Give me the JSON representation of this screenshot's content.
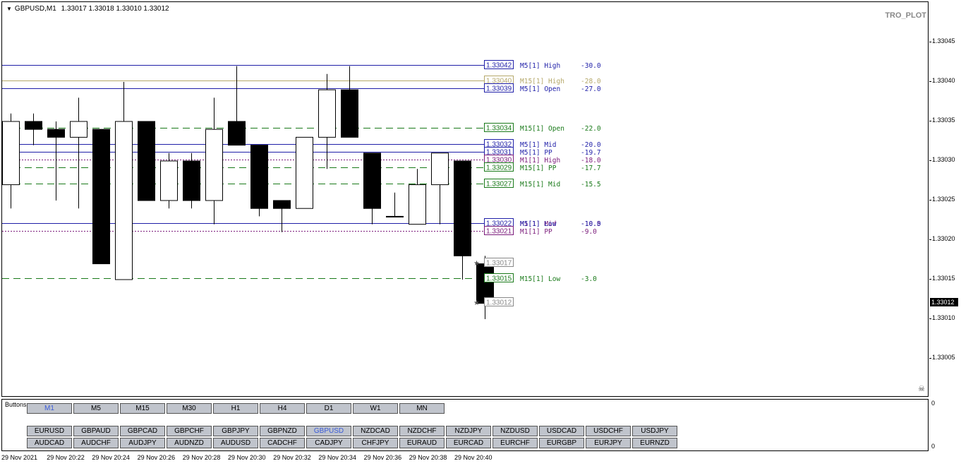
{
  "header": {
    "symbol": "GBPUSD,M1",
    "open": "1.33017",
    "high": "1.33018",
    "low": "1.33010",
    "close": "1.33012"
  },
  "plot_name": "TRO_PLOT",
  "current_price": "1.33012",
  "price_axis": [
    "1.33045",
    "1.33040",
    "1.33035",
    "1.33030",
    "1.33025",
    "1.33020",
    "1.33015",
    "1.33010",
    "1.33005"
  ],
  "colors": {
    "blue": "#1f1fa8",
    "olive": "#b5a86a",
    "green": "#1a7a1a",
    "purple": "#7a1a7a",
    "gray": "#888888"
  },
  "candles": [
    {
      "o": 1.33027,
      "h": 1.33036,
      "l": 1.33024,
      "c": 1.33035
    },
    {
      "o": 1.33035,
      "h": 1.33036,
      "l": 1.33032,
      "c": 1.33034
    },
    {
      "o": 1.33034,
      "h": 1.33035,
      "l": 1.33025,
      "c": 1.33033
    },
    {
      "o": 1.33033,
      "h": 1.33038,
      "l": 1.33024,
      "c": 1.33035
    },
    {
      "o": 1.33034,
      "h": 1.33034,
      "l": 1.33017,
      "c": 1.33017
    },
    {
      "o": 1.33015,
      "h": 1.3304,
      "l": 1.33015,
      "c": 1.33035
    },
    {
      "o": 1.33035,
      "h": 1.33035,
      "l": 1.33025,
      "c": 1.33025
    },
    {
      "o": 1.33025,
      "h": 1.33031,
      "l": 1.33024,
      "c": 1.3303
    },
    {
      "o": 1.3303,
      "h": 1.33031,
      "l": 1.33024,
      "c": 1.33025
    },
    {
      "o": 1.33025,
      "h": 1.33038,
      "l": 1.33022,
      "c": 1.33034
    },
    {
      "o": 1.33035,
      "h": 1.33042,
      "l": 1.33032,
      "c": 1.33032
    },
    {
      "o": 1.33032,
      "h": 1.33032,
      "l": 1.33023,
      "c": 1.33024
    },
    {
      "o": 1.33025,
      "h": 1.33025,
      "l": 1.33021,
      "c": 1.33024
    },
    {
      "o": 1.33024,
      "h": 1.33033,
      "l": 1.33024,
      "c": 1.33033
    },
    {
      "o": 1.33033,
      "h": 1.33041,
      "l": 1.33029,
      "c": 1.33039
    },
    {
      "o": 1.33039,
      "h": 1.33042,
      "l": 1.33033,
      "c": 1.33033
    },
    {
      "o": 1.33031,
      "h": 1.33031,
      "l": 1.33022,
      "c": 1.33024
    },
    {
      "o": 1.33023,
      "h": 1.33026,
      "l": 1.33023,
      "c": 1.33023
    },
    {
      "o": 1.33022,
      "h": 1.33029,
      "l": 1.33022,
      "c": 1.33027
    },
    {
      "o": 1.33027,
      "h": 1.33031,
      "l": 1.33022,
      "c": 1.33031
    },
    {
      "o": 1.3303,
      "h": 1.3303,
      "l": 1.33015,
      "c": 1.33018
    },
    {
      "o": 1.33017,
      "h": 1.33018,
      "l": 1.3301,
      "c": 1.33012
    }
  ],
  "levels": [
    {
      "price": 1.33042,
      "label": "1.33042",
      "text": "M5[1] High",
      "value": "-30.0",
      "color": "#1f1fa8",
      "style": "solid"
    },
    {
      "price": 1.3304,
      "label": "1.33040",
      "text": "M15[1] High",
      "value": "-28.0",
      "color": "#b5a86a",
      "style": "solid"
    },
    {
      "price": 1.33039,
      "label": "1.33039",
      "text": "M5[1] Open",
      "value": "-27.0",
      "color": "#1f1fa8",
      "style": "solid"
    },
    {
      "price": 1.33034,
      "label": "1.33034",
      "text": "M15[1] Open",
      "value": "-22.0",
      "color": "#1a7a1a",
      "style": "dash"
    },
    {
      "price": 1.33032,
      "label": "1.33032",
      "text": "M5[1] Mid",
      "value": "-20.0",
      "color": "#1f1fa8",
      "style": "solid"
    },
    {
      "price": 1.33031,
      "label": "1.33031",
      "text": "M5[1] PP",
      "value": "-19.7",
      "color": "#1f1fa8",
      "style": "solid"
    },
    {
      "price": 1.3303,
      "label": "1.33030",
      "text": "M1[1] High",
      "value": "-18.0",
      "color": "#7a1a7a",
      "style": "dot"
    },
    {
      "price": 1.33029,
      "label": "1.33029",
      "text": "M15[1] PP",
      "value": "-17.7",
      "color": "#1a7a1a",
      "style": "dash"
    },
    {
      "price": 1.33027,
      "label": "1.33027",
      "text": "M15[1] Mid",
      "value": "-15.5",
      "color": "#1a7a1a",
      "style": "dash"
    },
    {
      "price": 1.33022,
      "label": "1.33022",
      "text": "M1[1] Mid",
      "value": "-10.5",
      "color": "#7a1a7a",
      "style": "dot"
    },
    {
      "price": 1.33022,
      "label": "1.33022",
      "text": "M5[1] Low",
      "value": "-10.0",
      "color": "#1f1fa8",
      "style": "solid"
    },
    {
      "price": 1.33021,
      "label": "1.33021",
      "text": "M1[1] PP",
      "value": "-9.0",
      "color": "#7a1a7a",
      "style": "dot"
    },
    {
      "price": 1.33017,
      "label": "1.33017",
      "text": "",
      "value": "",
      "color": "#888888",
      "style": "none"
    },
    {
      "price": 1.33015,
      "label": "1.33015",
      "text": "M15[1] Low",
      "value": "-3.0",
      "color": "#1a7a1a",
      "style": "dash"
    },
    {
      "price": 1.33012,
      "label": "1.33012",
      "text": "",
      "value": "",
      "color": "#888888",
      "style": "none"
    }
  ],
  "panel": {
    "title": "Buttons",
    "axis_top": "0",
    "axis_bottom": "0",
    "timeframes": [
      "M1",
      "M5",
      "M15",
      "M30",
      "H1",
      "H4",
      "D1",
      "W1",
      "MN"
    ],
    "active_timeframe": "M1",
    "pairs_row1": [
      "EURUSD",
      "GBPAUD",
      "GBPCAD",
      "GBPCHF",
      "GBPJPY",
      "GBPNZD",
      "GBPUSD",
      "NZDCAD",
      "NZDCHF",
      "NZDJPY",
      "NZDUSD",
      "USDCAD",
      "USDCHF",
      "USDJPY"
    ],
    "pairs_row2": [
      "AUDCAD",
      "AUDCHF",
      "AUDJPY",
      "AUDNZD",
      "AUDUSD",
      "CADCHF",
      "CADJPY",
      "CHFJPY",
      "EURAUD",
      "EURCAD",
      "EURCHF",
      "EURGBP",
      "EURJPY",
      "EURNZD"
    ],
    "active_pair": "GBPUSD"
  },
  "time_axis": [
    "29 Nov 2021",
    "29 Nov 20:22",
    "29 Nov 20:24",
    "29 Nov 20:26",
    "29 Nov 20:28",
    "29 Nov 20:30",
    "29 Nov 20:32",
    "29 Nov 20:34",
    "29 Nov 20:36",
    "29 Nov 20:38",
    "29 Nov 20:40"
  ]
}
